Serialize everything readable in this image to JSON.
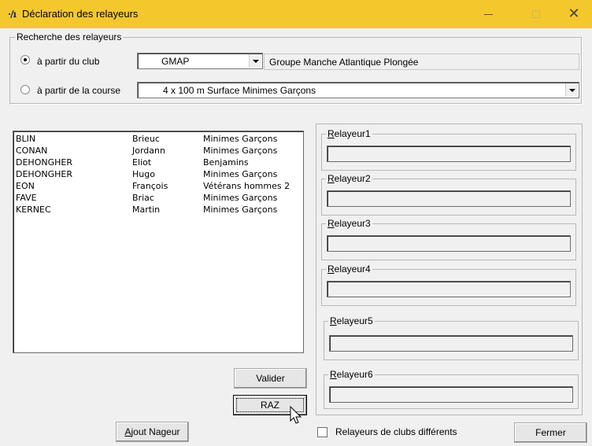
{
  "window": {
    "icon": "·/ı",
    "title": "Déclaration des relayeurs",
    "min_icon": "minimize-icon",
    "max_icon": "maximize-icon",
    "close_glyph": "✕"
  },
  "search": {
    "legend": "Recherche des relayeurs",
    "by_club_label": "à partir du club",
    "by_club_checked": true,
    "club_code": "GMAP",
    "club_name": "Groupe Manche Atlantique Plongée",
    "by_race_label": "à partir de la course",
    "by_race_checked": false,
    "race": "4 x 100 m Surface  Minimes Garçons"
  },
  "swimmers": [
    {
      "name": "BLIN",
      "first": "Brieuc",
      "category": "Minimes Garçons"
    },
    {
      "name": "CONAN",
      "first": "Jordann",
      "category": "Minimes Garçons"
    },
    {
      "name": "DEHONGHER",
      "first": "Eliot",
      "category": "Benjamins"
    },
    {
      "name": "DEHONGHER",
      "first": "Hugo",
      "category": "Minimes Garçons"
    },
    {
      "name": "EON",
      "first": "François",
      "category": "Vétérans hommes 2"
    },
    {
      "name": "FAVE",
      "first": "Briac",
      "category": "Minimes Garçons"
    },
    {
      "name": "KERNEC",
      "first": "Martin",
      "category": "Minimes Garçons"
    }
  ],
  "relayers": [
    {
      "mnemonic": "R",
      "rest": "elayeur1",
      "value": ""
    },
    {
      "mnemonic": "R",
      "rest": "elayeur2",
      "value": ""
    },
    {
      "mnemonic": "R",
      "rest": "elayeur3",
      "value": ""
    },
    {
      "mnemonic": "R",
      "rest": "elayeur4",
      "value": ""
    },
    {
      "mnemonic": "R",
      "rest": "elayeur5",
      "value": ""
    },
    {
      "mnemonic": "R",
      "rest": "elayeur6",
      "value": ""
    }
  ],
  "buttons": {
    "validate": "Valider",
    "reset": "RAZ",
    "add_swimmer_mnemonic": "A",
    "add_swimmer_rest": "jout Nageur",
    "close": "Fermer"
  },
  "options": {
    "different_clubs_label": "Relayeurs de clubs différents",
    "different_clubs_checked": false
  },
  "colors": {
    "titlebar": "#f4c82c",
    "window_bg": "#f0f0f0"
  }
}
